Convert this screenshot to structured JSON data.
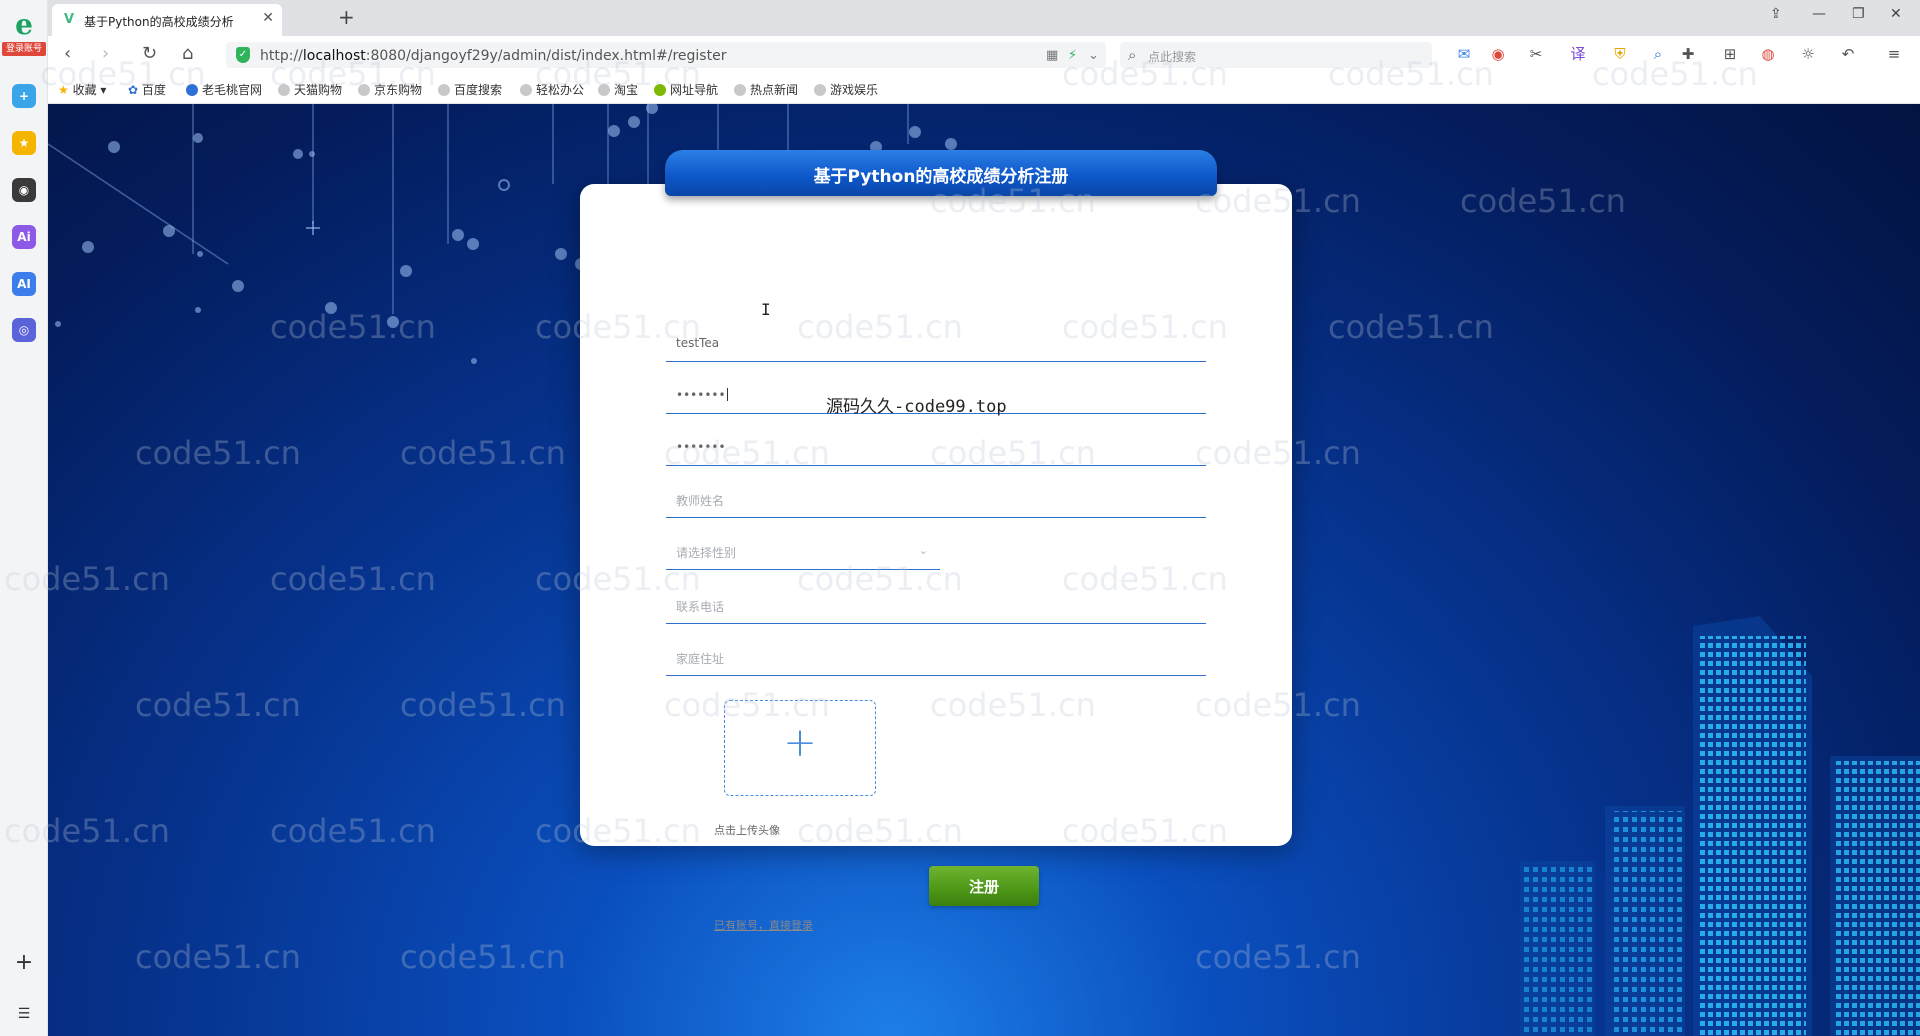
{
  "browser": {
    "sidebar_logo": "e",
    "sidebar_badge": "登录账号",
    "sidebar_icons": [
      "+",
      "★",
      "◉",
      "Ai",
      "AI",
      "◎"
    ],
    "tab_title": "基于Python的高校成绩分析",
    "url_prefix": "http://",
    "url_host": "localhost",
    "url_path": ":8080/djangoyf29y/admin/dist/index.html#/register",
    "search_placeholder": "点此搜索",
    "bookmarks": [
      "收藏",
      "百度",
      "老毛桃官网",
      "天猫购物",
      "京东购物",
      "百度搜索",
      "轻松办公",
      "淘宝",
      "网址导航",
      "热点新闻",
      "游戏娱乐"
    ]
  },
  "form": {
    "title": "基于Python的高校成绩分析注册",
    "account_value": "testTea",
    "password_value": "•••••••",
    "confirm_password_value": "•••••••",
    "teacher_name_placeholder": "教师姓名",
    "gender_placeholder": "请选择性别",
    "phone_placeholder": "联系电话",
    "address_placeholder": "家庭住址",
    "upload_label": "点击上传头像",
    "register_button": "注册",
    "login_link": "已有账号，直接登录"
  },
  "overlay_text": "源码久久-code99.top",
  "watermark_text": "code51.cn"
}
